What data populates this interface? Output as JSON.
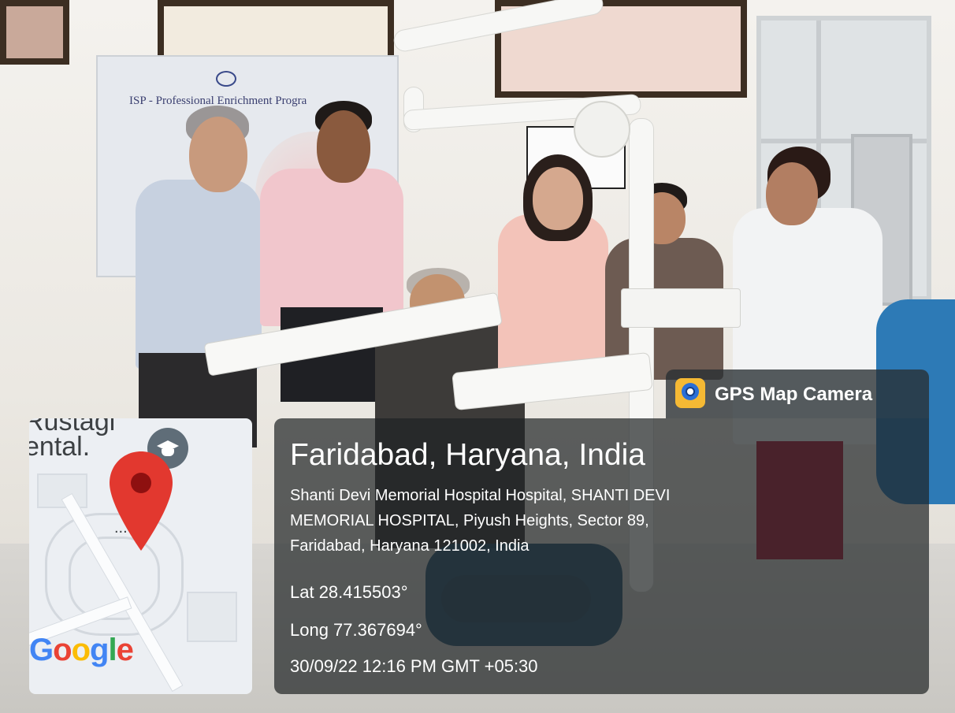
{
  "overlay": {
    "app_name": "GPS Map Camera",
    "app_icon": "gps-map-camera-icon",
    "city": "Faridabad, Haryana, India",
    "address_line1": "Shanti Devi Memorial Hospital Hospital, SHANTI DEVI",
    "address_line2": "MEMORIAL HOSPITAL, Piyush Heights, Sector 89,",
    "address_line3": "Faridabad, Haryana 121002, India",
    "latitude": "Lat 28.415503°",
    "longitude": "Long 77.367694°",
    "timestamp": "30/09/22 12:16 PM GMT +05:30"
  },
  "map": {
    "place_label_line1": "Rustagi",
    "place_label_line2": "ental.",
    "more_indicator": "...",
    "place_icon": "school-icon",
    "pin_icon": "location-pin-icon",
    "attribution": "Google",
    "attribution_letters": [
      "G",
      "o",
      "o",
      "g",
      "l",
      "e"
    ]
  },
  "scene": {
    "poster_title": "ISP - Professional Enrichment Progra"
  },
  "colors": {
    "panel_bg": "#1e2224",
    "pin_red": "#e2382f",
    "google_blue": "#4285f4",
    "google_red": "#ea4335",
    "google_yellow": "#fbbc05",
    "google_green": "#34a853"
  }
}
